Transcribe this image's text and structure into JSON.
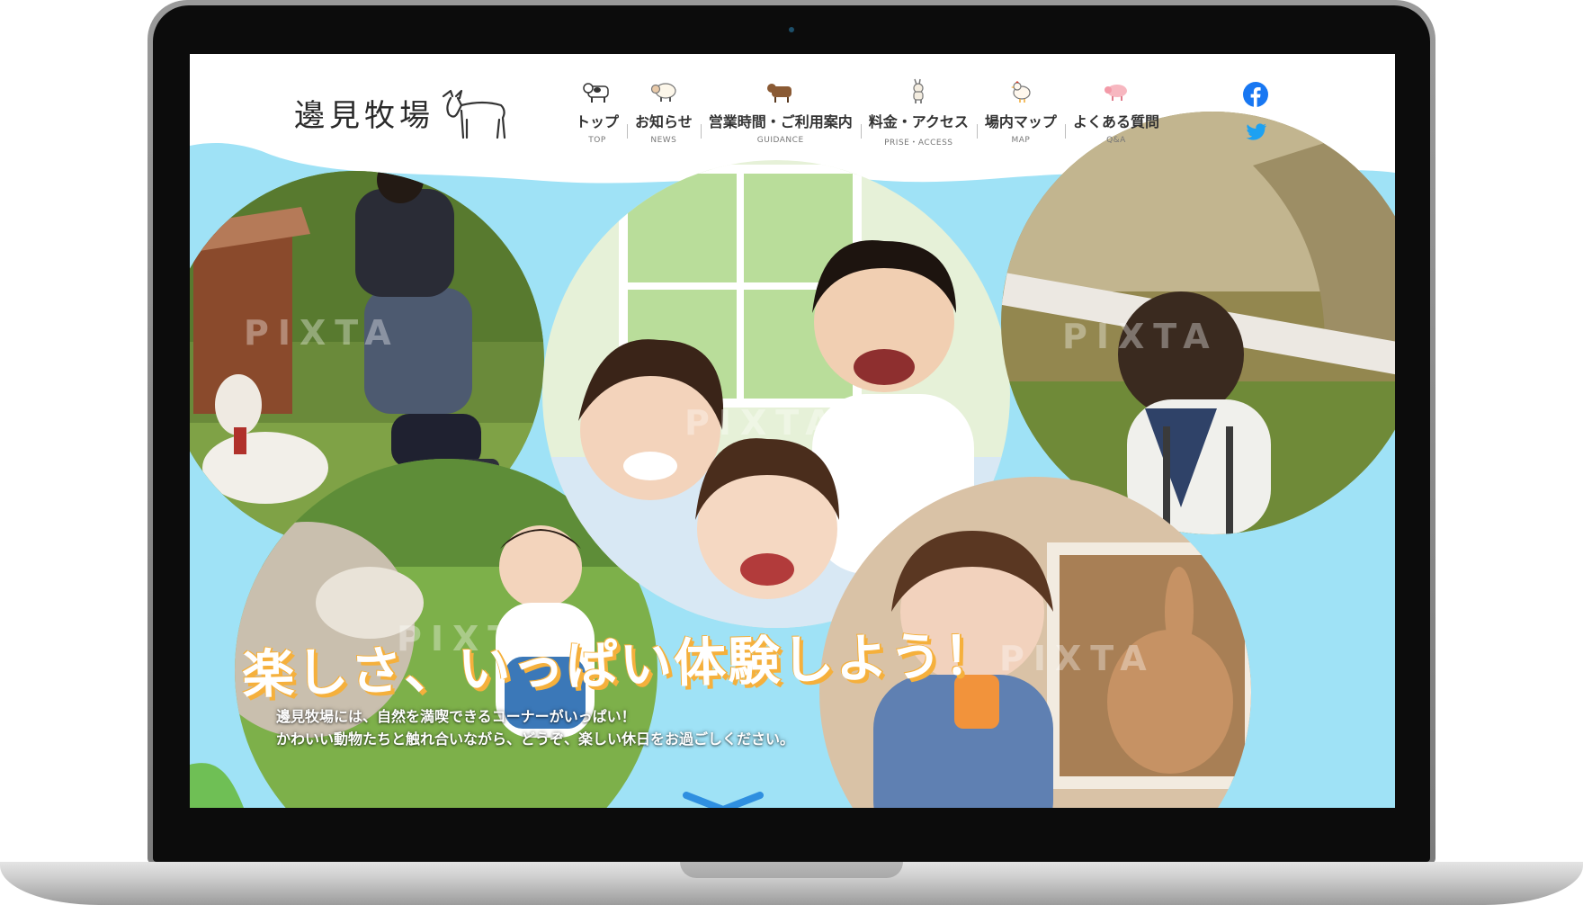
{
  "site": {
    "logo_text": "邊見牧場"
  },
  "nav": [
    {
      "label": "トップ",
      "sub": "TOP",
      "icon": "cow-icon"
    },
    {
      "label": "お知らせ",
      "sub": "NEWS",
      "icon": "sheep-icon"
    },
    {
      "label": "営業時間・ご利用案内",
      "sub": "GUIDANCE",
      "icon": "brown-cow-icon"
    },
    {
      "label": "料金・アクセス",
      "sub": "PRISE・ACCESS",
      "icon": "goat-icon"
    },
    {
      "label": "場内マップ",
      "sub": "MAP",
      "icon": "chicken-icon"
    },
    {
      "label": "よくある質問",
      "sub": "Q&A",
      "icon": "pig-icon"
    }
  ],
  "social": [
    {
      "name": "facebook-icon",
      "color": "#1877f2"
    },
    {
      "name": "twitter-icon",
      "color": "#1da1f2"
    }
  ],
  "hero": {
    "title": "楽しさ、いっぱい体験しよう！",
    "lead_line1": "邊見牧場には、自然を満喫できるコーナーがいっぱい！",
    "lead_line2": "かわいい動物たちと触れ合いながら、どうぞ、楽しい休日をお過ごしください。",
    "watermark": "PIXTA"
  },
  "colors": {
    "sky": "#9fe2f6",
    "title_outline": "#f5b03c",
    "scroll_arrow": "#2f8fe0"
  }
}
